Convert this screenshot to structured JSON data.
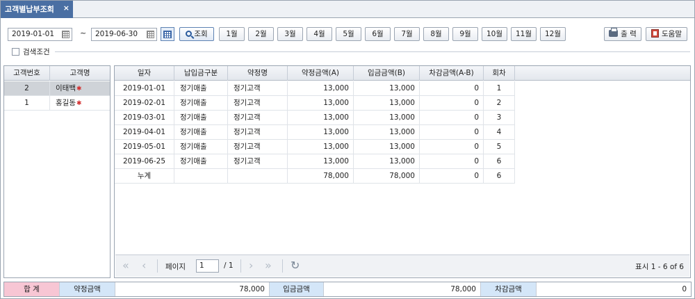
{
  "tab": {
    "title": "고객별납부조회",
    "close": "×"
  },
  "toolbar": {
    "date_from": "2019-01-01",
    "date_to": "2019-06-30",
    "tilde": "~",
    "search_label": "조회",
    "months": [
      "1월",
      "2월",
      "3월",
      "4월",
      "5월",
      "6월",
      "7월",
      "8월",
      "9월",
      "10월",
      "11월",
      "12월"
    ],
    "print_label": "출 력",
    "help_label": "도움말"
  },
  "search_conditions": {
    "label": "검색조건"
  },
  "customer_grid": {
    "headers": [
      "고객번호",
      "고객명"
    ],
    "rows": [
      {
        "no": "2",
        "name": "이태백",
        "selected": true
      },
      {
        "no": "1",
        "name": "홍길동",
        "selected": false
      }
    ]
  },
  "detail_grid": {
    "headers": [
      "일자",
      "납입금구분",
      "약정명",
      "약정금액(A)",
      "입금금액(B)",
      "차감금액(A-B)",
      "회차"
    ],
    "rows": [
      [
        "2019-01-01",
        "정기매출",
        "정기고객",
        "13,000",
        "13,000",
        "0",
        "1"
      ],
      [
        "2019-02-01",
        "정기매출",
        "정기고객",
        "13,000",
        "13,000",
        "0",
        "2"
      ],
      [
        "2019-03-01",
        "정기매출",
        "정기고객",
        "13,000",
        "13,000",
        "0",
        "3"
      ],
      [
        "2019-04-01",
        "정기매출",
        "정기고객",
        "13,000",
        "13,000",
        "0",
        "4"
      ],
      [
        "2019-05-01",
        "정기매출",
        "정기고객",
        "13,000",
        "13,000",
        "0",
        "5"
      ],
      [
        "2019-06-25",
        "정기매출",
        "정기고객",
        "13,000",
        "13,000",
        "0",
        "6"
      ]
    ],
    "total_row": [
      "누계",
      "",
      "",
      "78,000",
      "78,000",
      "0",
      "6"
    ]
  },
  "pager": {
    "page_label": "페이지",
    "page_value": "1",
    "page_total": "/ 1",
    "display_info": "표시 1 - 6 of 6"
  },
  "summary": {
    "total_label": "합 계",
    "contract_label": "약정금액",
    "contract_value": "78,000",
    "deposit_label": "입금금액",
    "deposit_value": "78,000",
    "deduct_label": "차감금액",
    "deduct_value": "0"
  },
  "colors": {
    "tab_bg": "#4a6fa3",
    "selected_row": "#cfd3d8",
    "total_label_bg": "#f7c6d4",
    "sum_label_bg": "#d4e6f8",
    "required_star": "#d32f2f"
  }
}
